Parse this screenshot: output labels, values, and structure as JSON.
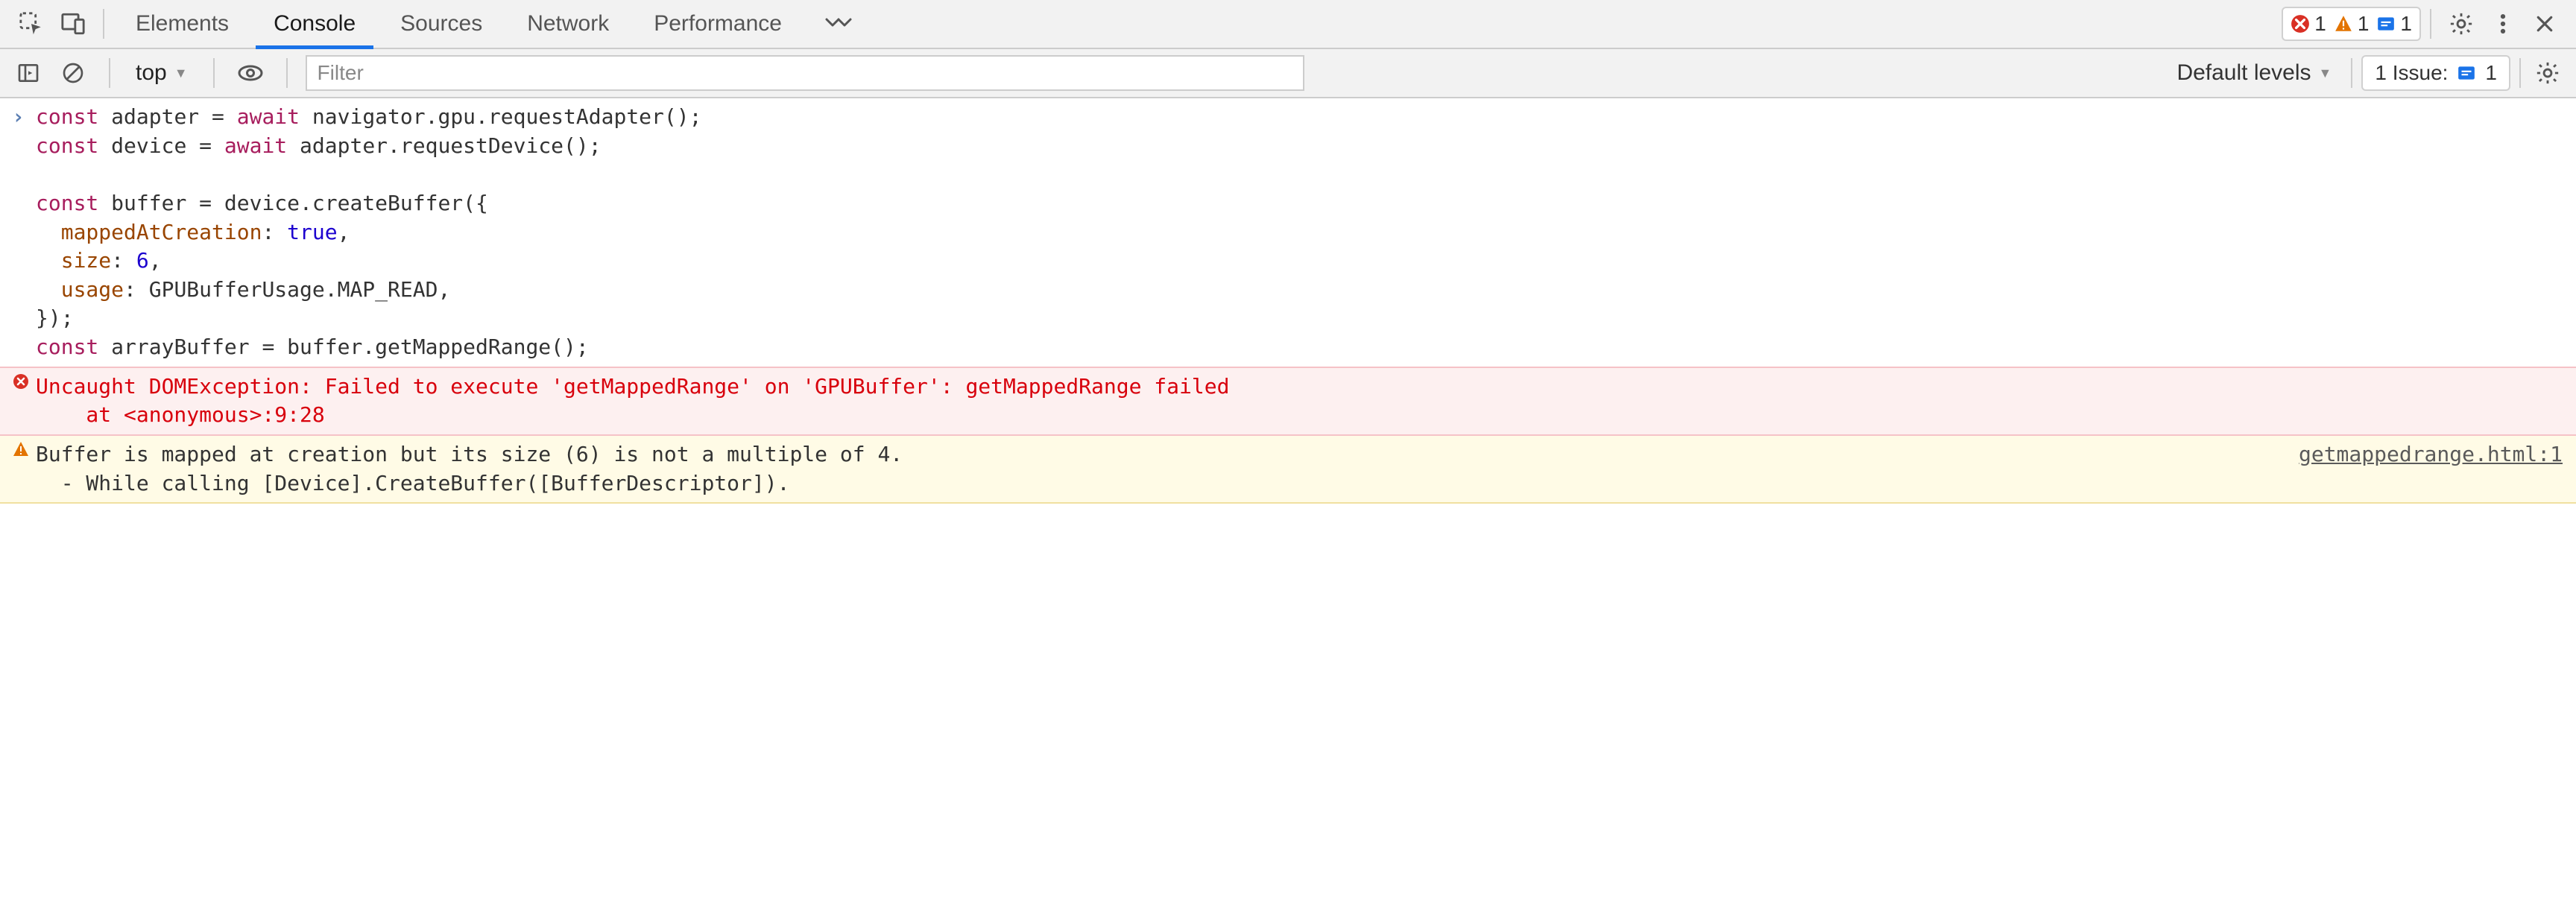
{
  "tabbar": {
    "tabs": [
      "Elements",
      "Console",
      "Sources",
      "Network",
      "Performance"
    ],
    "active_index": 1,
    "error_count": "1",
    "warning_count": "1",
    "info_count": "1"
  },
  "toolbar": {
    "context": "top",
    "filter_placeholder": "Filter",
    "levels_label": "Default levels",
    "issues_label_prefix": "1 Issue:",
    "issues_count": "1"
  },
  "console": {
    "input_code": {
      "line1_a": "const",
      "line1_b": " adapter = ",
      "line1_c": "await",
      "line1_d": " navigator.gpu.requestAdapter();",
      "line2_a": "const",
      "line2_b": " device = ",
      "line2_c": "await",
      "line2_d": " adapter.requestDevice();",
      "blank": "",
      "line4_a": "const",
      "line4_b": " buffer = device.createBuffer({",
      "line5_k": "  mappedAtCreation",
      "line5_v": ": ",
      "line5_val": "true",
      "line5_end": ",",
      "line6_k": "  size",
      "line6_v": ": ",
      "line6_val": "6",
      "line6_end": ",",
      "line7_k": "  usage",
      "line7_v": ": GPUBufferUsage.MAP_READ,",
      "line8": "});",
      "line9_a": "const",
      "line9_b": " arrayBuffer = buffer.getMappedRange();"
    },
    "error": {
      "line1": "Uncaught DOMException: Failed to execute 'getMappedRange' on 'GPUBuffer': getMappedRange failed",
      "line2": "    at <anonymous>:9:28"
    },
    "warning": {
      "text_line1": "Buffer is mapped at creation but its size (6) is not a multiple of 4.",
      "text_line2": "  - While calling [Device].CreateBuffer([BufferDescriptor]).",
      "source": "getmappedrange.html:1"
    }
  }
}
